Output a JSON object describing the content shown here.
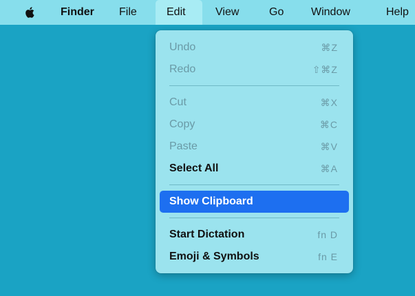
{
  "menubar": {
    "app_name": "Finder",
    "items": [
      "File",
      "Edit",
      "View",
      "Go",
      "Window",
      "Help"
    ],
    "active_item": "Edit"
  },
  "edit_menu": {
    "items": [
      {
        "label": "Undo",
        "shortcut": "⌘Z",
        "enabled": false
      },
      {
        "label": "Redo",
        "shortcut": "⇧⌘Z",
        "enabled": false
      },
      {
        "label": "Cut",
        "shortcut": "⌘X",
        "enabled": false
      },
      {
        "label": "Copy",
        "shortcut": "⌘C",
        "enabled": false
      },
      {
        "label": "Paste",
        "shortcut": "⌘V",
        "enabled": false
      },
      {
        "label": "Select All",
        "shortcut": "⌘A",
        "enabled": true
      },
      {
        "label": "Show Clipboard",
        "shortcut": "",
        "enabled": true,
        "highlighted": true
      },
      {
        "label": "Start Dictation",
        "shortcut": "fn D",
        "enabled": true
      },
      {
        "label": "Emoji & Symbols",
        "shortcut": "fn E",
        "enabled": true
      }
    ]
  },
  "colors": {
    "desktop": "#1aa3c4",
    "menubar": "#87deec",
    "menu_bg": "#9be3ee",
    "highlight": "#1d6ff0",
    "disabled_text": "#6a9aa6"
  },
  "icons": {
    "apple": "apple-logo-icon"
  }
}
